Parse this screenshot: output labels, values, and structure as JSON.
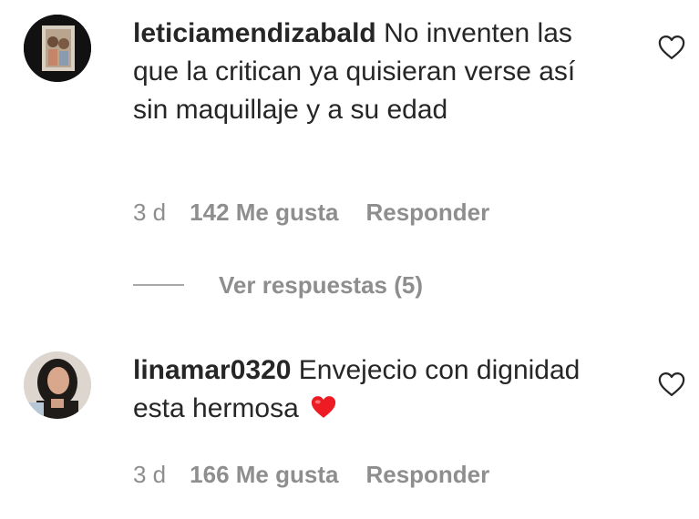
{
  "comments": [
    {
      "username": "leticiamendizabald",
      "text": " No inventen las que la critican ya quisieran verse así sin maquillaje y a su edad",
      "time": "3 d",
      "likes": "142 Me gusta",
      "reply_label": "Responder",
      "avatar_icon": "user-avatar-photo",
      "like_icon": "heart-outline-icon"
    },
    {
      "username": "linamar0320",
      "text": " Envejecio con dignidad esta hermosa",
      "emoji": "❤️",
      "time": "3 d",
      "likes": "166 Me gusta",
      "reply_label": "Responder",
      "avatar_icon": "user-avatar-photo",
      "like_icon": "heart-outline-icon"
    }
  ],
  "view_replies": {
    "label": "Ver respuestas (5)"
  },
  "colors": {
    "text": "#262626",
    "meta": "#8e8e8e",
    "emoji_heart": "#ed1c24"
  }
}
